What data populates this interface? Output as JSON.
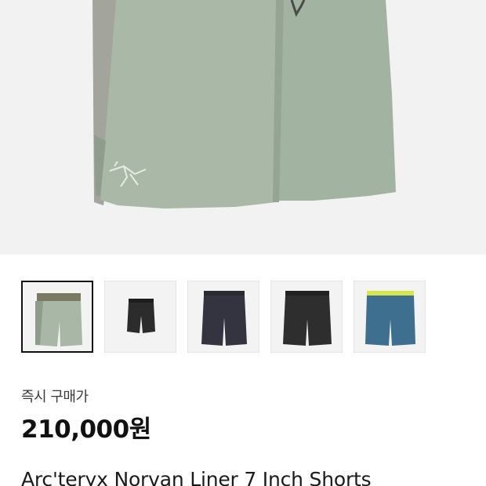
{
  "product": {
    "hero_image": "sage-green-shorts-with-bird-logo",
    "thumbnails": [
      {
        "name": "sage-green-shorts",
        "selected": true
      },
      {
        "name": "black-shorts-small",
        "selected": false
      },
      {
        "name": "charcoal-shorts",
        "selected": false
      },
      {
        "name": "black-shorts",
        "selected": false
      },
      {
        "name": "blue-shorts-yellow-waistband",
        "selected": false
      }
    ],
    "price_label": "즉시 구매가",
    "price": "210,000원",
    "title": "Arc'teryx Norvan Liner 7 Inch Shorts"
  },
  "colors": {
    "hero_bg": "#f2f2f2",
    "sage": "#a9b8a6",
    "sage_dark": "#8e9c8c",
    "side_panel": "#a3a49b",
    "black": "#2c2c2c",
    "charcoal": "#343440",
    "blue": "#3f6f8e",
    "yellow": "#d6e64b"
  }
}
